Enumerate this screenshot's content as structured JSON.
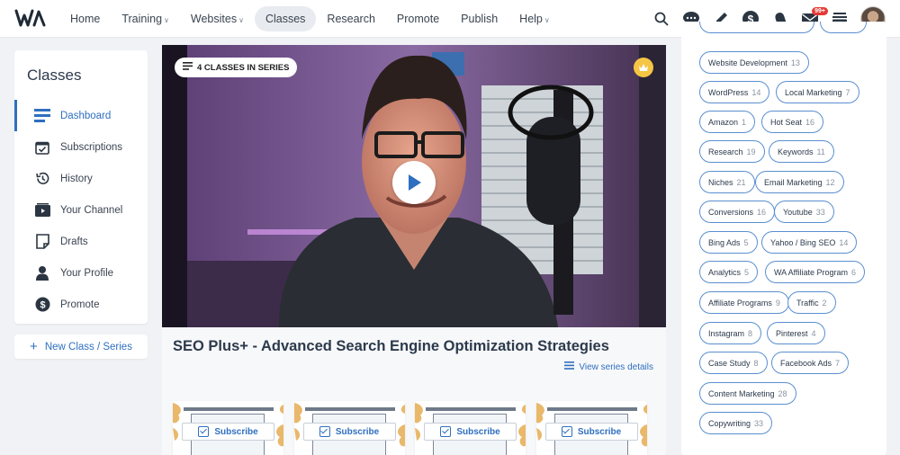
{
  "nav": {
    "logo": "WA",
    "items": [
      {
        "label": "Home",
        "caret": false,
        "active": false
      },
      {
        "label": "Training",
        "caret": true,
        "active": false
      },
      {
        "label": "Websites",
        "caret": true,
        "active": false
      },
      {
        "label": "Classes",
        "caret": false,
        "active": true
      },
      {
        "label": "Research",
        "caret": false,
        "active": false
      },
      {
        "label": "Promote",
        "caret": false,
        "active": false
      },
      {
        "label": "Publish",
        "caret": false,
        "active": false
      },
      {
        "label": "Help",
        "caret": true,
        "active": false
      }
    ],
    "icons": [
      "search-icon",
      "chat-icon",
      "pencil-icon",
      "dollar-icon",
      "bell-icon",
      "mail-icon",
      "inbox-icon"
    ],
    "mail_badge": "99+"
  },
  "sidebar": {
    "title": "Classes",
    "items": [
      {
        "label": "Dashboard",
        "icon": "dashboard-icon",
        "active": true
      },
      {
        "label": "Subscriptions",
        "icon": "calendar-check-icon",
        "active": false
      },
      {
        "label": "History",
        "icon": "history-icon",
        "active": false
      },
      {
        "label": "Your Channel",
        "icon": "channel-icon",
        "active": false
      },
      {
        "label": "Drafts",
        "icon": "drafts-icon",
        "active": false
      },
      {
        "label": "Your Profile",
        "icon": "profile-icon",
        "active": false
      },
      {
        "label": "Promote",
        "icon": "dollar-circle-icon",
        "active": false
      }
    ],
    "new_class": "New Class / Series"
  },
  "main": {
    "series_chip": "4 CLASSES IN SERIES",
    "title": "SEO Plus+ - Advanced Search Engine Optimization Strategies",
    "series_link": "View series details",
    "cards": [
      {
        "button": "Subscribe"
      },
      {
        "button": "Subscribe"
      },
      {
        "button": "Subscribe"
      },
      {
        "button": "Subscribe"
      }
    ]
  },
  "tags": [
    {
      "label": "Website Development",
      "count": "13"
    },
    {
      "label": "WordPress",
      "count": "14"
    },
    {
      "label": "Local Marketing",
      "count": "7"
    },
    {
      "label": "Amazon",
      "count": "1"
    },
    {
      "label": "Hot Seat",
      "count": "16"
    },
    {
      "label": "Research",
      "count": "19"
    },
    {
      "label": "Keywords",
      "count": "11"
    },
    {
      "label": "Niches",
      "count": "21"
    },
    {
      "label": "Email Marketing",
      "count": "12"
    },
    {
      "label": "Conversions",
      "count": "16"
    },
    {
      "label": "Youtube",
      "count": "33"
    },
    {
      "label": "Bing Ads",
      "count": "5"
    },
    {
      "label": "Yahoo / Bing SEO",
      "count": "14"
    },
    {
      "label": "Analytics",
      "count": "5"
    },
    {
      "label": "WA Affiliate Program",
      "count": "6"
    },
    {
      "label": "Affiliate Programs",
      "count": "9"
    },
    {
      "label": "Traffic",
      "count": "2"
    },
    {
      "label": "Instagram",
      "count": "8"
    },
    {
      "label": "Pinterest",
      "count": "4"
    },
    {
      "label": "Case Study",
      "count": "8"
    },
    {
      "label": "Facebook Ads",
      "count": "7"
    },
    {
      "label": "Content Marketing",
      "count": "28"
    },
    {
      "label": "Copywriting",
      "count": "33"
    }
  ],
  "colors": {
    "accent": "#2f6fbf",
    "tag_border": "#5a8fd0",
    "crown": "#f5c544",
    "badge": "#e53935"
  }
}
